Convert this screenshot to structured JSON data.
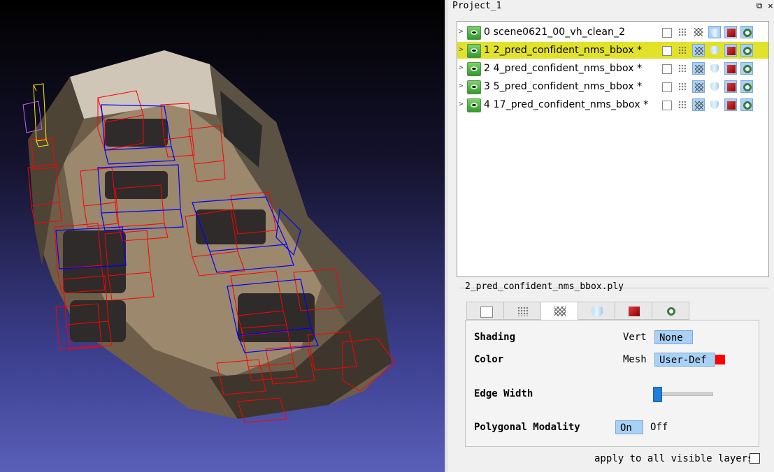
{
  "window": {
    "title": "Project_1",
    "float_glyph": "⧉",
    "close_glyph": "✕"
  },
  "layers": [
    {
      "index": "0",
      "name": "scene0621_00_vh_clean_2",
      "modified": false,
      "selected": false,
      "visible": true
    },
    {
      "index": "1",
      "name": "2_pred_confident_nms_bbox *",
      "modified": true,
      "selected": true,
      "visible": true
    },
    {
      "index": "2",
      "name": "4_pred_confident_nms_bbox *",
      "modified": true,
      "selected": false,
      "visible": true
    },
    {
      "index": "3",
      "name": "5_pred_confident_nms_bbox *",
      "modified": true,
      "selected": false,
      "visible": true
    },
    {
      "index": "4",
      "name": "17_pred_confident_nms_bbox *",
      "modified": true,
      "selected": false,
      "visible": true
    }
  ],
  "row_icons": [
    "box-icon",
    "points-icon",
    "wireframe-icon",
    "cylinder-icon",
    "red-texture-icon",
    "gear-icon"
  ],
  "decorations": {
    "file": "2_pred_confident_nms_bbox.ply",
    "tabs": [
      "box-icon",
      "points-icon",
      "wireframe-icon",
      "cylinder-icon",
      "red-texture-icon",
      "gear-icon"
    ],
    "active_tab": 2,
    "shading": {
      "label": "Shading",
      "mode": "Vert",
      "value": "None"
    },
    "color": {
      "label": "Color",
      "mode": "Mesh",
      "value": "User-Def",
      "swatch": "#ff0000"
    },
    "edge_width": {
      "label": "Edge Width",
      "value_fraction": 0.0
    },
    "polygonal_modality": {
      "label": "Polygonal Modality",
      "on": "On",
      "off": "Off",
      "selected": "On"
    }
  },
  "apply_all": {
    "label": "apply to all visible layers",
    "checked": false
  },
  "colors": {
    "selected_row": "#e2e22a",
    "toggle_on": "#a9d1f5",
    "bbox_red": "#ff0000",
    "bbox_blue": "#0000ff"
  }
}
